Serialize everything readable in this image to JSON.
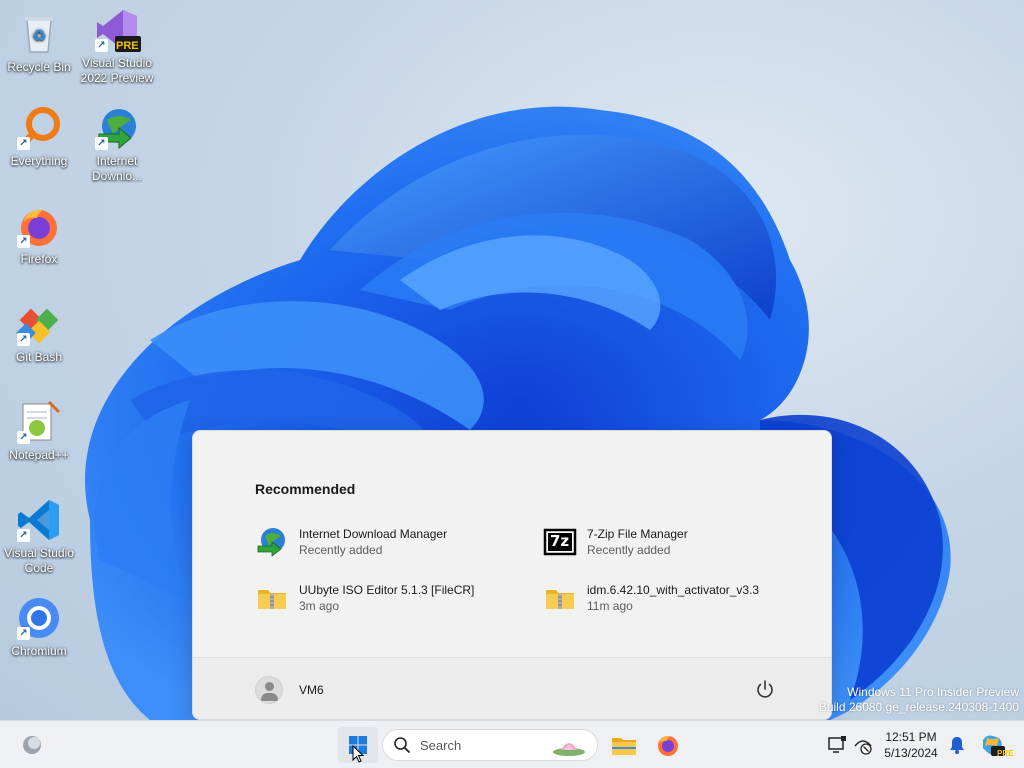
{
  "desktop": {
    "icons": [
      {
        "label": "Recycle Bin",
        "icon": "recycle-bin-icon"
      },
      {
        "label": "Visual Studio 2022 Preview",
        "icon": "visual-studio-preview-icon",
        "badge": "PRE"
      },
      {
        "label": "Everything",
        "icon": "everything-search-icon"
      },
      {
        "label": "Internet Downlo...",
        "icon": "internet-download-manager-icon"
      },
      {
        "label": "Firefox",
        "icon": "firefox-icon"
      },
      {
        "label": "Git Bash",
        "icon": "git-bash-icon"
      },
      {
        "label": "Notepad++",
        "icon": "notepad-plus-plus-icon"
      },
      {
        "label": "Visual Studio Code",
        "icon": "vscode-icon"
      },
      {
        "label": "Chromium",
        "icon": "chromium-icon"
      }
    ]
  },
  "start_menu": {
    "recommended_title": "Recommended",
    "items": [
      {
        "name": "Internet Download Manager",
        "sub": "Recently added",
        "icon": "internet-download-manager-icon"
      },
      {
        "name": "7-Zip File Manager",
        "sub": "Recently added",
        "icon": "7zip-icon",
        "icon_text": "7z"
      },
      {
        "name": "UUbyte ISO Editor 5.1.3 [FileCR]",
        "sub": "3m ago",
        "icon": "zip-folder-icon"
      },
      {
        "name": "idm.6.42.10_with_activator_v3.3",
        "sub": "11m ago",
        "icon": "zip-folder-icon"
      }
    ],
    "user_name": "VM6",
    "power_icon": "power-icon"
  },
  "watermark": {
    "line1": "Windows 11 Pro Insider Preview",
    "line2": "Build 26080.ge_release.240308-1400"
  },
  "taskbar": {
    "widgets_icon": "weather-widget-icon",
    "start_icon": "windows-start-icon",
    "search_placeholder": "Search",
    "pinned": [
      "file-explorer-icon",
      "firefox-icon"
    ],
    "tray": [
      "display-icon",
      "network-disconnected-icon"
    ],
    "time": "12:51 PM",
    "date": "5/13/2024",
    "notification_icon": "bell-icon",
    "copilot_badge": "PRE"
  },
  "colors": {
    "accent": "#0078d4",
    "bloom": "#1a5fe0"
  }
}
